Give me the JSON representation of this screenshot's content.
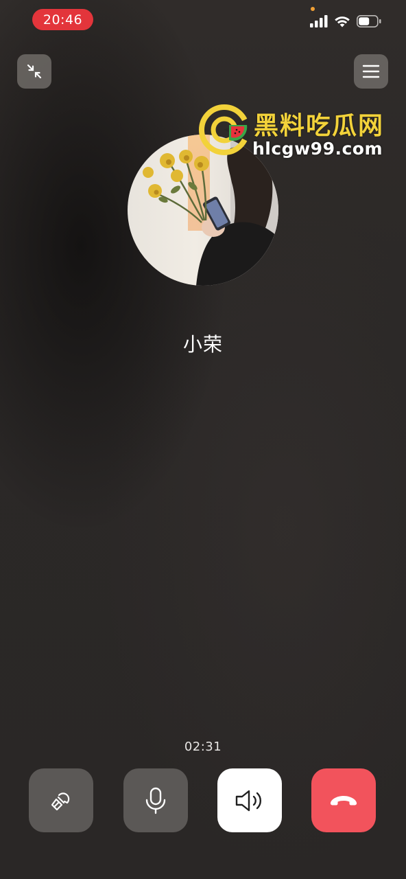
{
  "status_bar": {
    "time": "20:46",
    "battery_level": 0.55,
    "icons": [
      "signal-icon",
      "wifi-icon",
      "battery-icon"
    ]
  },
  "top_actions": {
    "minimize_icon": "minimize-arrows-icon",
    "menu_icon": "hamburger-menu-icon"
  },
  "watermark": {
    "title": "黑料吃瓜网",
    "url": "hlcgw99.com"
  },
  "contact": {
    "name": "小荣"
  },
  "call": {
    "duration": "02:31"
  },
  "controls": [
    {
      "icon": "camera-off-icon"
    },
    {
      "icon": "microphone-icon"
    },
    {
      "icon": "speaker-icon",
      "active": true
    },
    {
      "icon": "hang-up-icon"
    }
  ],
  "colors": {
    "time_pill": "#e3353b",
    "hangup": "#f2535c",
    "control_gray": "#5b5856",
    "watermark_yellow": "#f2d23a"
  }
}
